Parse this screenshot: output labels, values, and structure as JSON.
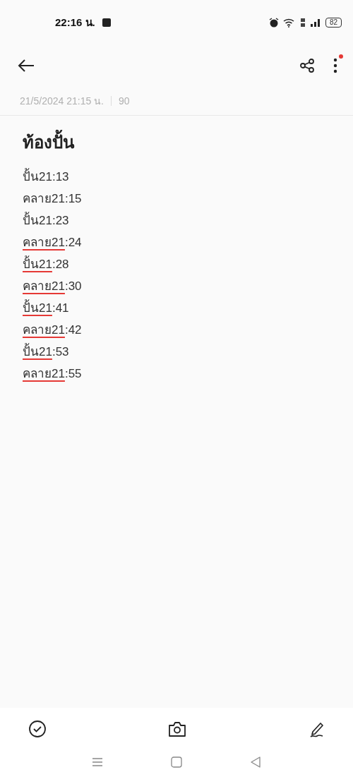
{
  "status_bar": {
    "time": "22:16 น.",
    "battery": "82"
  },
  "toolbar": {
    "menu_notification": true
  },
  "meta": {
    "modified": "21/5/2024 21:15 น.",
    "char_count": "90"
  },
  "note": {
    "title": "ท้องปั้น",
    "lines": [
      {
        "word": "ปั้น21",
        "rest": ":13",
        "spell_flag": false
      },
      {
        "word": "คลาย21",
        "rest": ":15",
        "spell_flag": false
      },
      {
        "word": "ปั้น21",
        "rest": ":23",
        "spell_flag": false
      },
      {
        "word": "คลาย21",
        "rest": ":24",
        "spell_flag": true
      },
      {
        "word": "ปั้น21",
        "rest": ":28",
        "spell_flag": true
      },
      {
        "word": "คลาย21",
        "rest": ":30",
        "spell_flag": true
      },
      {
        "word": "ปั้น21",
        "rest": ":41",
        "spell_flag": true
      },
      {
        "word": "คลาย21",
        "rest": ":42",
        "spell_flag": true
      },
      {
        "word": "ปั้น21",
        "rest": ":53",
        "spell_flag": true
      },
      {
        "word": "คลาย21",
        "rest": ":55",
        "spell_flag": true
      }
    ]
  }
}
